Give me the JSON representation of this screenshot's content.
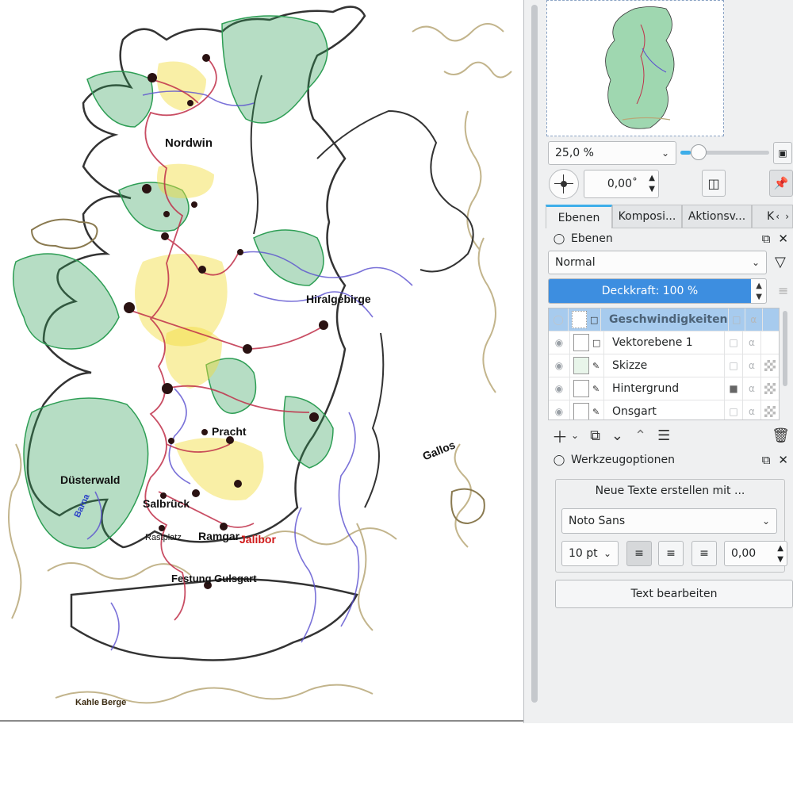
{
  "map": {
    "labels": {
      "nordwin": "Nordwin",
      "hiralgebirge": "Hiralgebirge",
      "pracht": "Pracht",
      "gallos": "Gallos",
      "duesterwald": "Düsterwald",
      "barna": "Barna",
      "salbrueck": "Salbrück",
      "rastplatz": "Rastplatz",
      "ramgar": "Ramgar",
      "jalibor": "Jalibor",
      "festung": "Festung Gulsgart",
      "kahle_berge": "Kahle Berge"
    },
    "colors": {
      "outline": "#333333",
      "forest": "#2e9e55",
      "river": "#5a4fcf",
      "road": "#c0304a",
      "field": "#f2dc3a",
      "mountain": "#b8a878",
      "town": "#2a1212",
      "jalibor": "#d01818"
    }
  },
  "navigator": {
    "zoom_value": "25,0 %",
    "rotation_value": "0,00˚",
    "zoom_level": 0.12
  },
  "tabs": [
    {
      "label": "Ebenen"
    },
    {
      "label": "Komposi..."
    },
    {
      "label": "Aktionsv..."
    },
    {
      "label": "K"
    }
  ],
  "layers_docker": {
    "title": "Ebenen",
    "blend_mode": "Normal",
    "opacity_label": "Deckkraft:  100 %",
    "layers": [
      {
        "name": "Geschwindigkeiten",
        "selected": true
      },
      {
        "name": "Vektorebene 1"
      },
      {
        "name": "Skizze"
      },
      {
        "name": "Hintergrund"
      },
      {
        "name": "Onsgart"
      }
    ]
  },
  "tool_options": {
    "title": "Werkzeugoptionen",
    "create_label": "Neue Texte erstellen mit ...",
    "font": "Noto Sans",
    "font_size": "10 pt",
    "spacing_value": "0,00",
    "edit_button": "Text bearbeiten"
  }
}
